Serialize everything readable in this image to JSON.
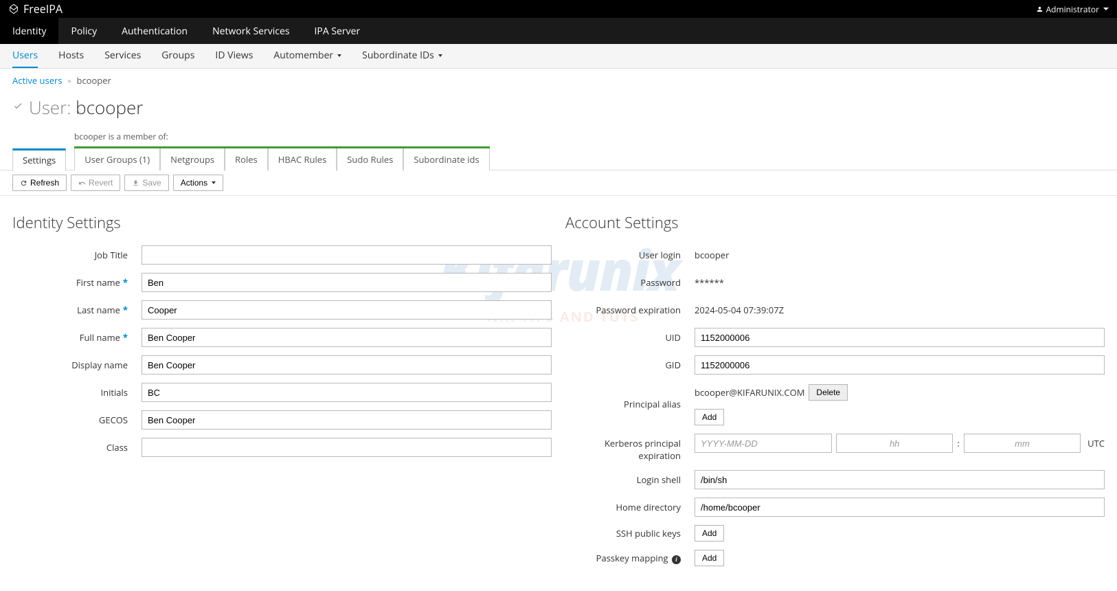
{
  "brand": "FreeIPA",
  "user_menu": {
    "label": "Administrator"
  },
  "main_nav": {
    "identity": "Identity",
    "policy": "Policy",
    "authentication": "Authentication",
    "network_services": "Network Services",
    "ipa_server": "IPA Server"
  },
  "sub_nav": {
    "users": "Users",
    "hosts": "Hosts",
    "services": "Services",
    "groups": "Groups",
    "id_views": "ID Views",
    "automember": "Automember",
    "subordinate_ids": "Subordinate IDs"
  },
  "breadcrumb": {
    "parent": "Active users",
    "current": "bcooper"
  },
  "page_title": {
    "prefix": "User: ",
    "uid": "bcooper"
  },
  "member_label": "bcooper is a member of:",
  "tabs": {
    "settings": "Settings",
    "user_groups": "User Groups (1)",
    "netgroups": "Netgroups",
    "roles": "Roles",
    "hbac_rules": "HBAC Rules",
    "sudo_rules": "Sudo Rules",
    "subordinate_ids": "Subordinate ids"
  },
  "toolbar": {
    "refresh": "Refresh",
    "revert": "Revert",
    "save": "Save",
    "actions": "Actions"
  },
  "sections": {
    "identity": "Identity Settings",
    "account": "Account Settings"
  },
  "labels": {
    "job_title": "Job Title",
    "first_name": "First name",
    "last_name": "Last name",
    "full_name": "Full name",
    "display_name": "Display name",
    "initials": "Initials",
    "gecos": "GECOS",
    "class": "Class",
    "user_login": "User login",
    "password": "Password",
    "password_expiration": "Password expiration",
    "uid": "UID",
    "gid": "GID",
    "principal_alias": "Principal alias",
    "kerberos_expiration": "Kerberos principal expiration",
    "login_shell": "Login shell",
    "home_directory": "Home directory",
    "ssh_public_keys": "SSH public keys",
    "passkey_mapping": "Passkey mapping"
  },
  "values": {
    "job_title": "",
    "first_name": "Ben",
    "last_name": "Cooper",
    "full_name": "Ben Cooper",
    "display_name": "Ben Cooper",
    "initials": "BC",
    "gecos": "Ben Cooper",
    "class": "",
    "user_login": "bcooper",
    "password": "******",
    "password_expiration": "2024-05-04 07:39:07Z",
    "uid": "1152000006",
    "gid": "1152000006",
    "principal_alias": "bcooper@KIFARUNIX.COM",
    "login_shell": "/bin/sh",
    "home_directory": "/home/bcooper"
  },
  "buttons": {
    "delete": "Delete",
    "add": "Add"
  },
  "placeholders": {
    "date": "YYYY-MM-DD",
    "hour": "hh",
    "minute": "mm"
  },
  "utc": "UTC",
  "watermark": {
    "title": "Kifarunix",
    "sub": "*NIX TIPS AND TUTS"
  }
}
